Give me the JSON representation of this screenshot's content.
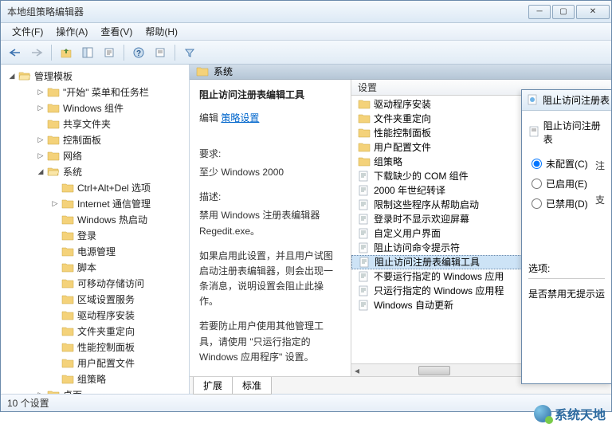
{
  "window": {
    "title": "本地组策略编辑器"
  },
  "menu": {
    "file": "文件(F)",
    "action": "操作(A)",
    "view": "查看(V)",
    "help": "帮助(H)"
  },
  "tree": {
    "root": "管理模板",
    "items": [
      {
        "label": "\"开始\" 菜单和任务栏",
        "indent": 2,
        "exp": "▷"
      },
      {
        "label": "Windows 组件",
        "indent": 2,
        "exp": "▷"
      },
      {
        "label": "共享文件夹",
        "indent": 2,
        "exp": ""
      },
      {
        "label": "控制面板",
        "indent": 2,
        "exp": "▷"
      },
      {
        "label": "网络",
        "indent": 2,
        "exp": "▷"
      },
      {
        "label": "系统",
        "indent": 2,
        "exp": "◢",
        "open": true
      },
      {
        "label": "Ctrl+Alt+Del 选项",
        "indent": 3,
        "exp": ""
      },
      {
        "label": "Internet 通信管理",
        "indent": 3,
        "exp": "▷"
      },
      {
        "label": "Windows 热启动",
        "indent": 3,
        "exp": ""
      },
      {
        "label": "登录",
        "indent": 3,
        "exp": ""
      },
      {
        "label": "电源管理",
        "indent": 3,
        "exp": ""
      },
      {
        "label": "脚本",
        "indent": 3,
        "exp": ""
      },
      {
        "label": "可移动存储访问",
        "indent": 3,
        "exp": ""
      },
      {
        "label": "区域设置服务",
        "indent": 3,
        "exp": ""
      },
      {
        "label": "驱动程序安装",
        "indent": 3,
        "exp": ""
      },
      {
        "label": "文件夹重定向",
        "indent": 3,
        "exp": ""
      },
      {
        "label": "性能控制面板",
        "indent": 3,
        "exp": ""
      },
      {
        "label": "用户配置文件",
        "indent": 3,
        "exp": ""
      },
      {
        "label": "组策略",
        "indent": 3,
        "exp": ""
      },
      {
        "label": "桌面",
        "indent": 2,
        "exp": "▷"
      }
    ]
  },
  "pathbar": {
    "label": "系统"
  },
  "detail": {
    "title": "阻止访问注册表编辑工具",
    "edit_label": "编辑",
    "edit_link": "策略设置",
    "req_label": "要求:",
    "req_value": "至少 Windows 2000",
    "desc_label": "描述:",
    "desc_p1": "禁用 Windows 注册表编辑器 Regedit.exe。",
    "desc_p2": "如果启用此设置，并且用户试图启动注册表编辑器，则会出现一条消息，说明设置会阻止此操作。",
    "desc_p3": "若要防止用户使用其他管理工具，请使用 \"只运行指定的 Windows 应用程序\" 设置。"
  },
  "list": {
    "header": "设置",
    "items": [
      {
        "type": "folder",
        "label": "驱动程序安装"
      },
      {
        "type": "folder",
        "label": "文件夹重定向"
      },
      {
        "type": "folder",
        "label": "性能控制面板"
      },
      {
        "type": "folder",
        "label": "用户配置文件"
      },
      {
        "type": "folder",
        "label": "组策略"
      },
      {
        "type": "policy",
        "label": "下载缺少的 COM 组件"
      },
      {
        "type": "policy",
        "label": "2000 年世纪转译"
      },
      {
        "type": "policy",
        "label": "限制这些程序从帮助启动"
      },
      {
        "type": "policy",
        "label": "登录时不显示欢迎屏幕"
      },
      {
        "type": "policy",
        "label": "自定义用户界面"
      },
      {
        "type": "policy",
        "label": "阻止访问命令提示符"
      },
      {
        "type": "policy",
        "label": "阻止访问注册表编辑工具",
        "selected": true
      },
      {
        "type": "policy",
        "label": "不要运行指定的 Windows 应用"
      },
      {
        "type": "policy",
        "label": "只运行指定的 Windows 应用程"
      },
      {
        "type": "policy",
        "label": "Windows 自动更新"
      }
    ]
  },
  "tabs": {
    "extended": "扩展",
    "standard": "标准"
  },
  "status": {
    "count": "10 个设置"
  },
  "dialog": {
    "title": "阻止访问注册表",
    "subtitle": "阻止访问注册表",
    "r_notconf": "未配置(C)",
    "r_enabled": "已启用(E)",
    "r_disabled": "已禁用(D)",
    "side1": "注",
    "side2": "支",
    "options_label": "选项:",
    "options_text": "是否禁用无提示运"
  },
  "watermark": "系统天地"
}
